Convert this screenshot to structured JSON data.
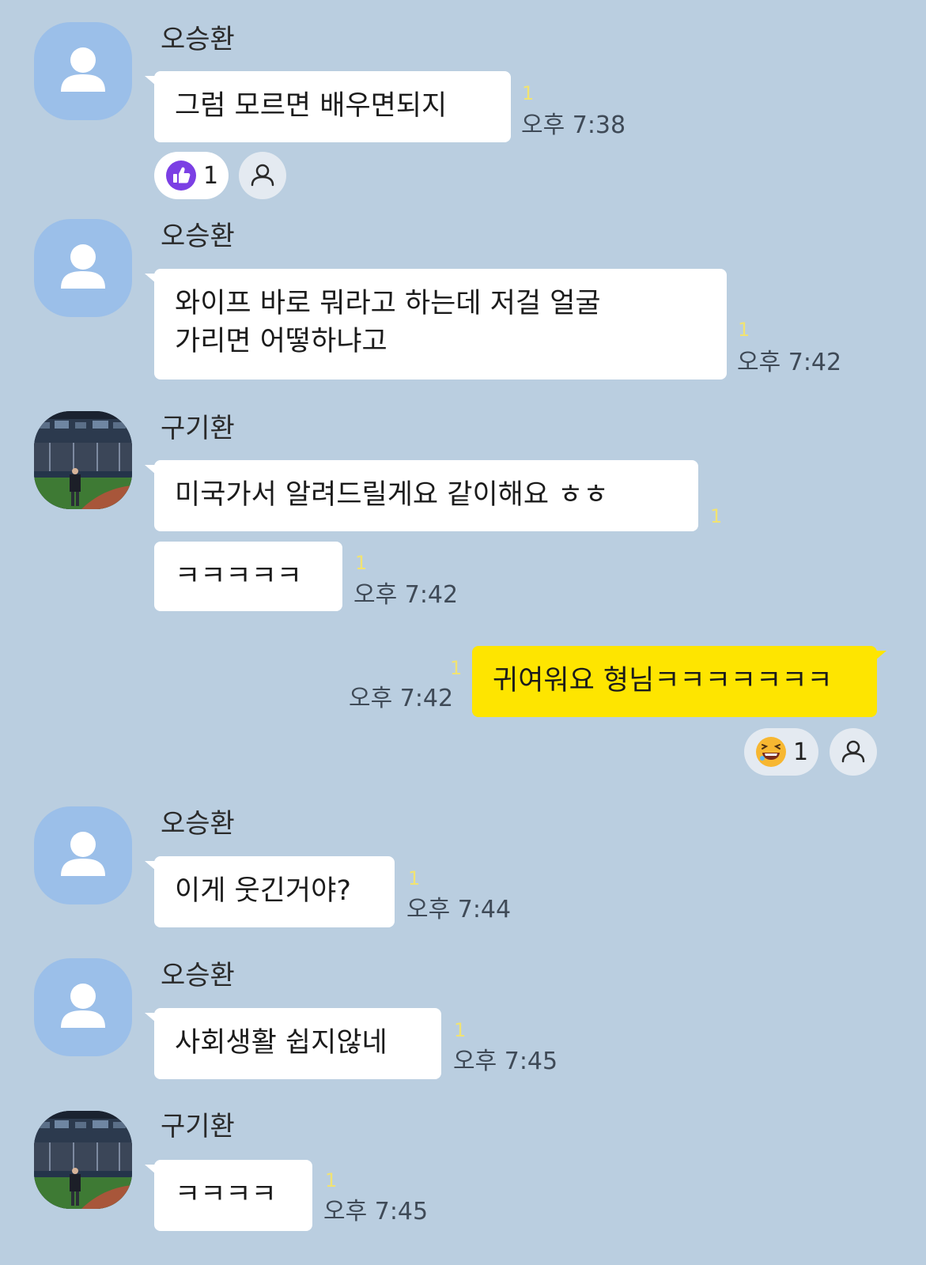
{
  "messages": [
    {
      "sender": "오승환",
      "lines": [
        "그럼 모르면 배우면되지"
      ],
      "unread": "1",
      "time": "오후 7:38",
      "reaction_count": "1"
    },
    {
      "sender": "오승환",
      "lines": [
        "와이프 바로 뭐라고 하는데 저걸 얼굴",
        "가리면 어떻하냐고"
      ],
      "unread": "1",
      "time": "오후 7:42"
    },
    {
      "sender": "구기환",
      "lines": [
        "미국가서 알려드릴게요 같이해요 ㅎㅎ"
      ],
      "unread": "1"
    },
    {
      "lines": [
        "ㅋㅋㅋㅋㅋ"
      ],
      "unread": "1",
      "time": "오후 7:42"
    },
    {
      "lines": [
        "귀여워요 형님ㅋㅋㅋㅋㅋㅋㅋ"
      ],
      "unread": "1",
      "time": "오후 7:42",
      "reaction_count": "1"
    },
    {
      "sender": "오승환",
      "lines": [
        "이게 웃긴거야?"
      ],
      "unread": "1",
      "time": "오후 7:44"
    },
    {
      "sender": "오승환",
      "lines": [
        "사회생활 쉽지않네"
      ],
      "unread": "1",
      "time": "오후 7:45"
    },
    {
      "sender": "구기환",
      "lines": [
        "ㅋㅋㅋㅋ"
      ],
      "unread": "1",
      "time": "오후 7:45"
    }
  ],
  "colors": {
    "background": "#bacee0",
    "incoming_bubble": "#ffffff",
    "outgoing_bubble": "#fee500",
    "unread_count": "#f1e372",
    "default_avatar": "#9bbfe9",
    "like_reaction": "#7b3fe4"
  },
  "icons": {
    "default_avatar": "person-silhouette-icon",
    "like_reaction": "thumbs-up-icon",
    "laugh_reaction": "laughing-emoji-icon",
    "reactors": "person-outline-icon"
  }
}
